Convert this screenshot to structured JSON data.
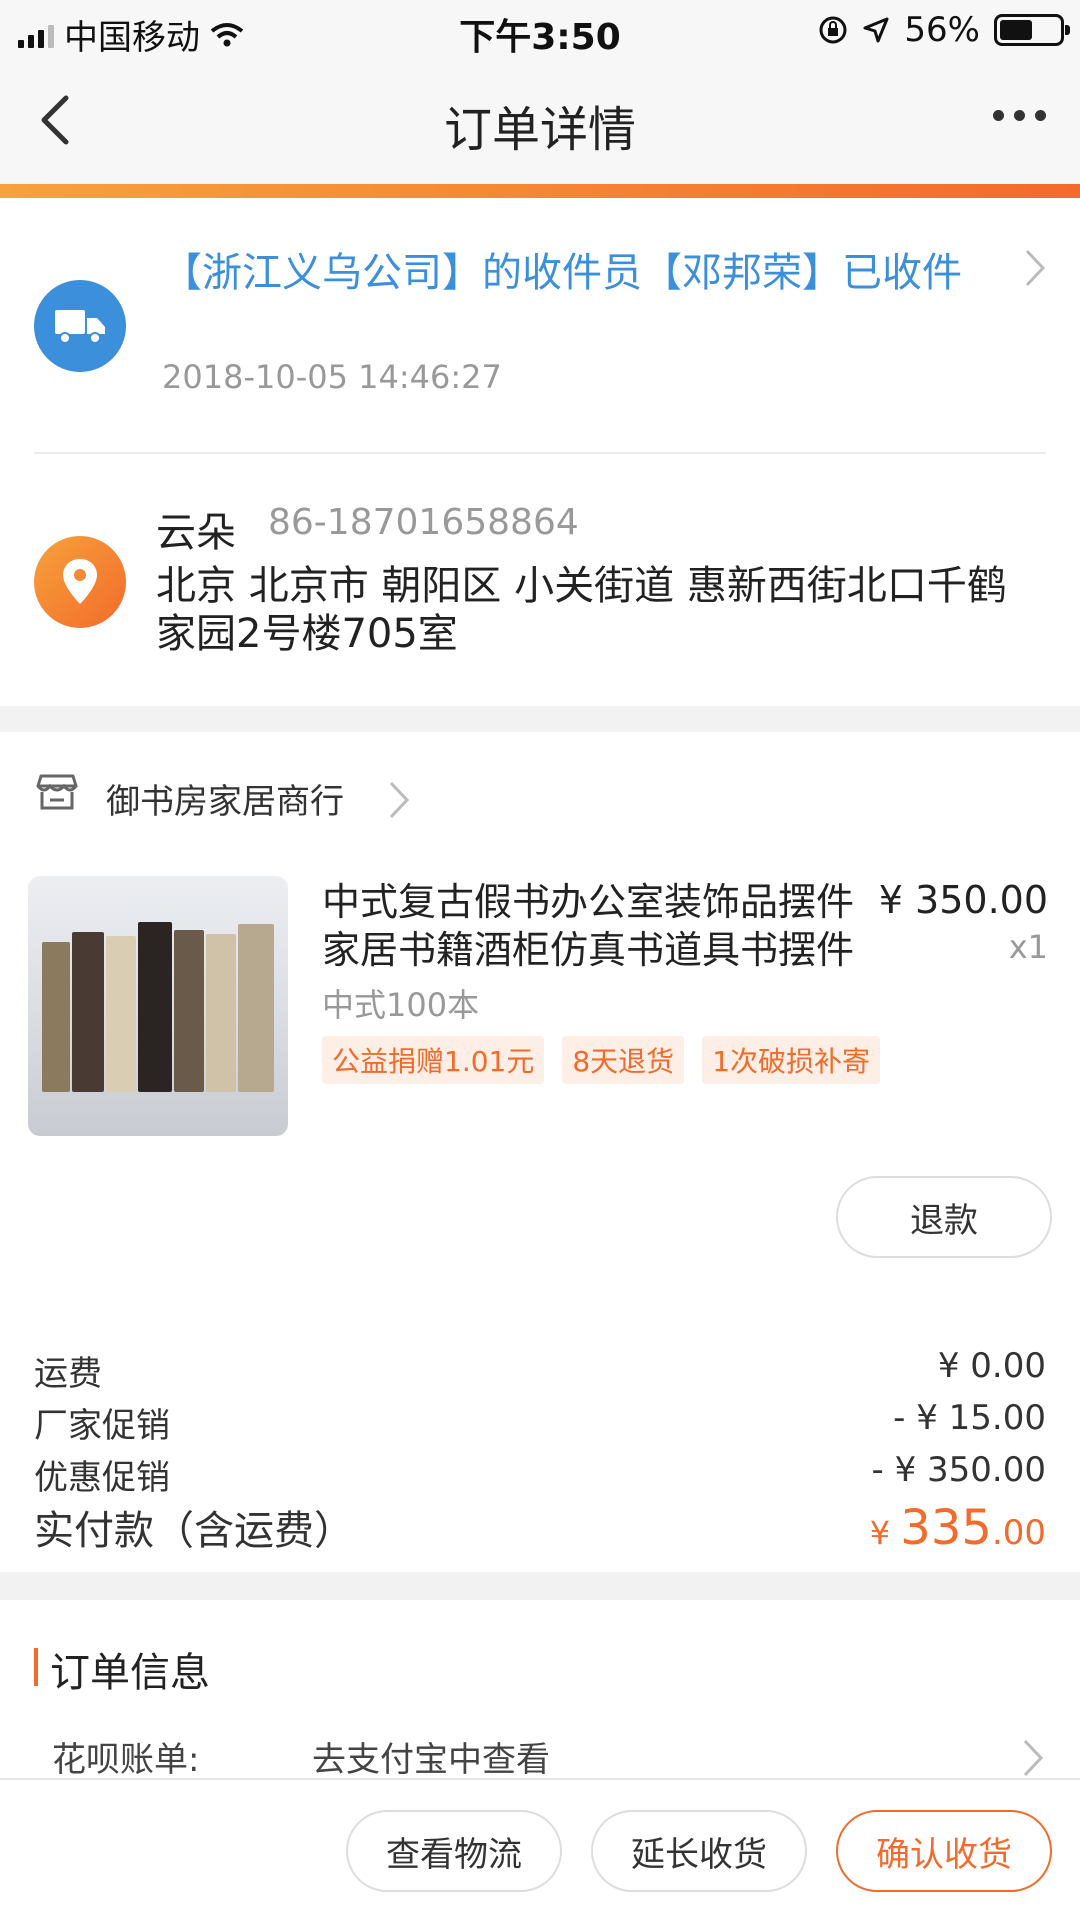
{
  "status_bar": {
    "carrier": "中国移动",
    "time": "下午3:50",
    "battery": "56%",
    "battery_level": 0.56
  },
  "nav": {
    "title": "订单详情"
  },
  "logistics": {
    "message": "【浙江义乌公司】的收件员【邓邦荣】已收件",
    "time": "2018-10-05 14:46:27"
  },
  "address": {
    "name": "云朵",
    "phone": "86-18701658864",
    "full": "北京 北京市 朝阳区 小关街道 惠新西街北口千鹤家园2号楼705室"
  },
  "shop": {
    "name": "御书房家居商行"
  },
  "product": {
    "title_line1": "中式复古假书办公室装饰品摆件",
    "title_line2": "家居书籍酒柜仿真书道具书摆件",
    "price": "¥ 350.00",
    "qty": "x1",
    "sku": "中式100本",
    "tags": [
      "公益捐赠1.01元",
      "8天退货",
      "1次破损补寄"
    ],
    "refund_label": "退款"
  },
  "fees": [
    {
      "label": "运费",
      "value": "¥ 0.00"
    },
    {
      "label": "厂家促销",
      "value": "- ¥ 15.00"
    },
    {
      "label": "优惠促销",
      "value": "- ¥ 350.00"
    }
  ],
  "total": {
    "label": "实付款（含运费）",
    "currency": "¥ ",
    "integer": "335",
    "decimal": ".00"
  },
  "order_info": {
    "title": "订单信息",
    "huabei_label": "花呗账单:",
    "huabei_value": "去支付宝中查看"
  },
  "actions": {
    "logistics": "查看物流",
    "extend": "延长收货",
    "confirm": "确认收货"
  },
  "colors": {
    "accent": "#f26b2b",
    "link_blue": "#3b8fdb"
  }
}
